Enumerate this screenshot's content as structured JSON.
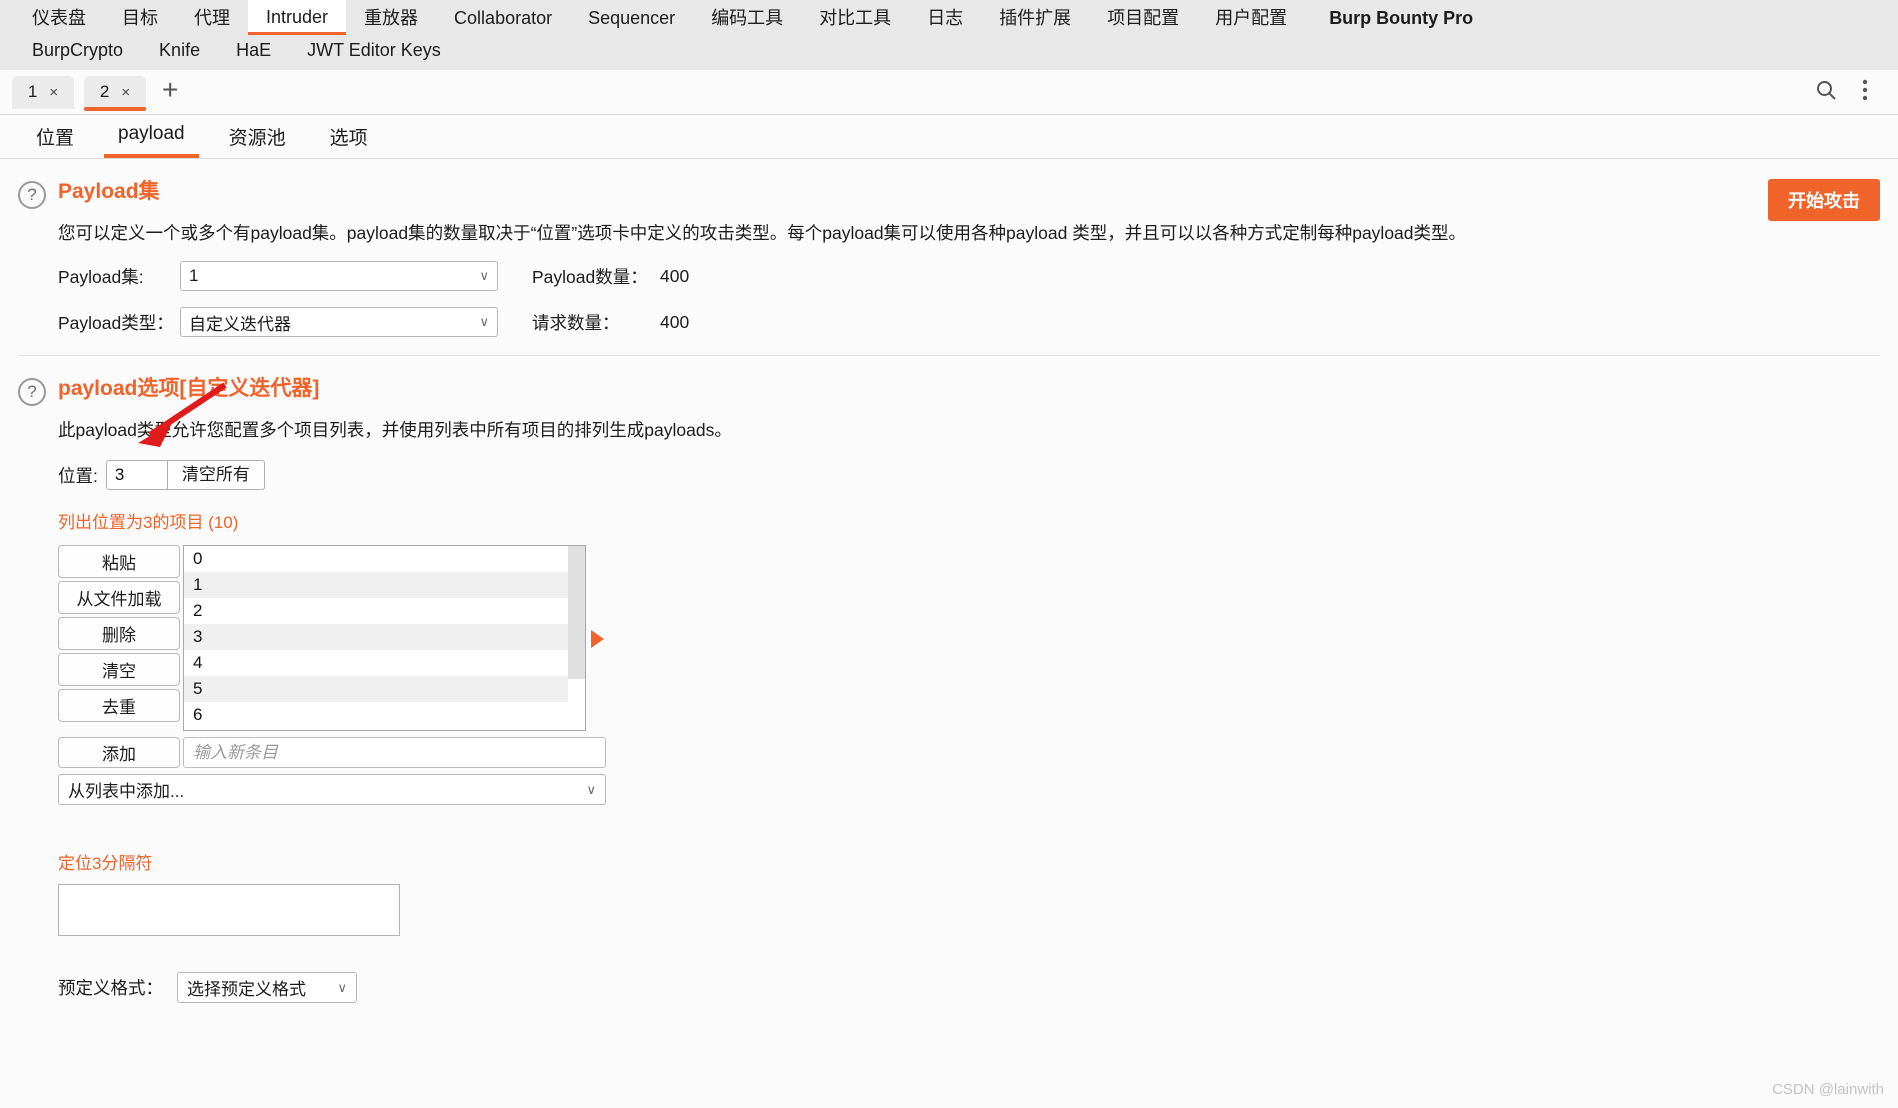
{
  "colors": {
    "accent": "#f0632b",
    "menu_bg": "#e8e8e8",
    "content_bg": "#fbfbfb",
    "annotation": "#e01b1b"
  },
  "menu": {
    "row1": [
      {
        "label": "仪表盘",
        "selected": false
      },
      {
        "label": "目标",
        "selected": false
      },
      {
        "label": "代理",
        "selected": false
      },
      {
        "label": "Intruder",
        "selected": true
      },
      {
        "label": "重放器",
        "selected": false
      },
      {
        "label": "Collaborator",
        "selected": false
      },
      {
        "label": "Sequencer",
        "selected": false
      },
      {
        "label": "编码工具",
        "selected": false
      },
      {
        "label": "对比工具",
        "selected": false
      },
      {
        "label": "日志",
        "selected": false
      },
      {
        "label": "插件扩展",
        "selected": false
      },
      {
        "label": "项目配置",
        "selected": false
      },
      {
        "label": "用户配置",
        "selected": false
      },
      {
        "label": "Burp Bounty Pro",
        "selected": false
      }
    ],
    "row2": [
      {
        "label": "BurpCrypto"
      },
      {
        "label": "Knife"
      },
      {
        "label": "HaE"
      },
      {
        "label": "JWT Editor Keys"
      }
    ]
  },
  "attack_tabs": {
    "tabs": [
      {
        "label": "1",
        "close": "×",
        "selected": false
      },
      {
        "label": "2",
        "close": "×",
        "selected": true
      }
    ],
    "add_label": "+",
    "search_icon": "search-icon",
    "overflow_icon": "kebab-menu-icon"
  },
  "sub_tabs": [
    {
      "label": "位置",
      "selected": false
    },
    {
      "label": "payload",
      "selected": true
    },
    {
      "label": "资源池",
      "selected": false
    },
    {
      "label": "选项",
      "selected": false
    }
  ],
  "payload_sets": {
    "help_glyph": "?",
    "title": "Payload集",
    "description": "您可以定义一个或多个有payload集。payload集的数量取决于“位置”选项卡中定义的攻击类型。每个payload集可以使用各种payload 类型，并且可以以各种方式定制每种payload类型。",
    "set_label": "Payload集:",
    "set_value": "1",
    "type_label": "Payload类型：",
    "type_value": "自定义迭代器",
    "count_label": "Payload数量：",
    "count_value": "400",
    "requests_label": "请求数量：",
    "requests_value": "400",
    "chevron": "∨"
  },
  "start_attack": {
    "label": "开始攻击"
  },
  "payload_options": {
    "help_glyph": "?",
    "title": "payload选项[自定义迭代器]",
    "description": "此payload类型允许您配置多个项目列表，并使用列表中所有项目的排列生成payloads。",
    "position_label": "位置:",
    "position_value": "3",
    "clear_all_label": "清空所有",
    "list_caption": "列出位置为3的项目 (10)",
    "buttons": [
      {
        "label": "粘贴"
      },
      {
        "label": "从文件加载"
      },
      {
        "label": "删除"
      },
      {
        "label": "清空"
      },
      {
        "label": "去重"
      }
    ],
    "list_items": [
      "0",
      "1",
      "2",
      "3",
      "4",
      "5",
      "6"
    ],
    "add_label": "添加",
    "add_placeholder": "输入新条目",
    "add_from_list_label": "从列表中添加...",
    "separator_label": "定位3分隔符",
    "separator_value": "",
    "predefined_label": "预定义格式：",
    "predefined_value": "选择预定义格式",
    "chevron": "∨",
    "marker_icon": "triangle-right-marker-icon"
  },
  "watermark": {
    "text": "CSDN @lainwith"
  }
}
